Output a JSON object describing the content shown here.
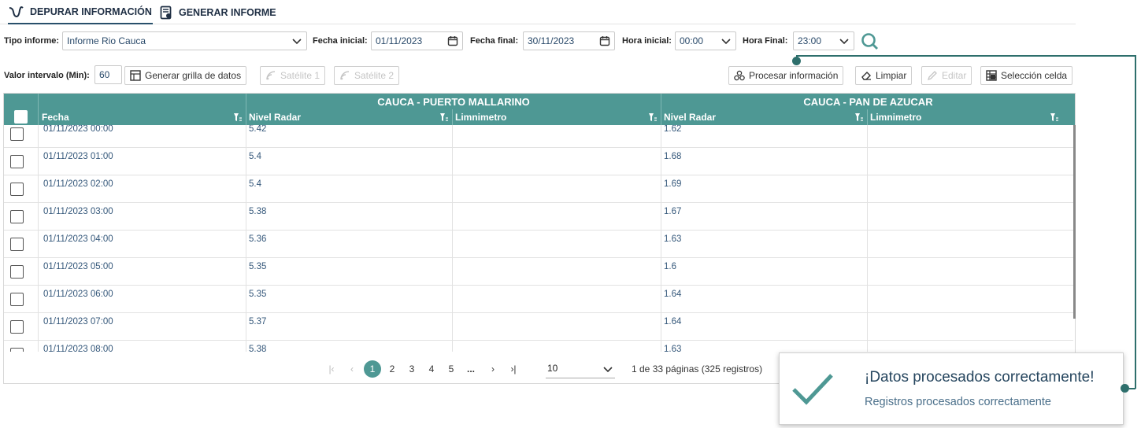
{
  "tabs": [
    {
      "label": "DEPURAR INFORMACIÓN",
      "icon": "pulse-icon"
    },
    {
      "label": "GENERAR INFORME",
      "icon": "report-icon"
    }
  ],
  "filters": {
    "tipo_label": "Tipo informe:",
    "tipo_value": "Informe Rio Cauca",
    "fecha_inicial_label": "Fecha inicial:",
    "fecha_inicial_value": "01/11/2023",
    "fecha_final_label": "Fecha final:",
    "fecha_final_value": "30/11/2023",
    "hora_inicial_label": "Hora inicial:",
    "hora_inicial_value": "00:00",
    "hora_final_label": "Hora Final:",
    "hora_final_value": "23:00",
    "intervalo_label": "Valor intervalo (Min):",
    "intervalo_value": "60"
  },
  "toolbar": {
    "generar": "Generar grilla de datos",
    "satelite1": "Satélite 1",
    "satelite2": "Satélite 2",
    "procesar": "Procesar información",
    "limpiar": "Limpiar",
    "editar": "Editar",
    "seleccion": "Selección celda"
  },
  "grid": {
    "groups": [
      "CAUCA - PUERTO MALLARINO",
      "CAUCA - PAN DE AZUCAR"
    ],
    "columns": [
      "Fecha",
      "Nivel Radar",
      "Limnimetro",
      "Nivel Radar",
      "Limnimetro"
    ],
    "rows": [
      [
        "01/11/2023 00:00",
        "5.42",
        "",
        "1.62",
        ""
      ],
      [
        "01/11/2023 01:00",
        "5.4",
        "",
        "1.68",
        ""
      ],
      [
        "01/11/2023 02:00",
        "5.4",
        "",
        "1.69",
        ""
      ],
      [
        "01/11/2023 03:00",
        "5.38",
        "",
        "1.67",
        ""
      ],
      [
        "01/11/2023 04:00",
        "5.36",
        "",
        "1.63",
        ""
      ],
      [
        "01/11/2023 05:00",
        "5.35",
        "",
        "1.6",
        ""
      ],
      [
        "01/11/2023 06:00",
        "5.35",
        "",
        "1.64",
        ""
      ],
      [
        "01/11/2023 07:00",
        "5.37",
        "",
        "1.64",
        ""
      ],
      [
        "01/11/2023 08:00",
        "5.38",
        "",
        "1.63",
        ""
      ]
    ]
  },
  "pager": {
    "pages": [
      "1",
      "2",
      "3",
      "4",
      "5",
      "..."
    ],
    "page_size": "10",
    "summary": "1 de 33 páginas (325 registros)"
  },
  "toast": {
    "title": "¡Datos procesados correctamente!",
    "message": "Registros procesados correctamente"
  },
  "colors": {
    "accent": "#4e9894",
    "dark": "#2e6f6c"
  }
}
